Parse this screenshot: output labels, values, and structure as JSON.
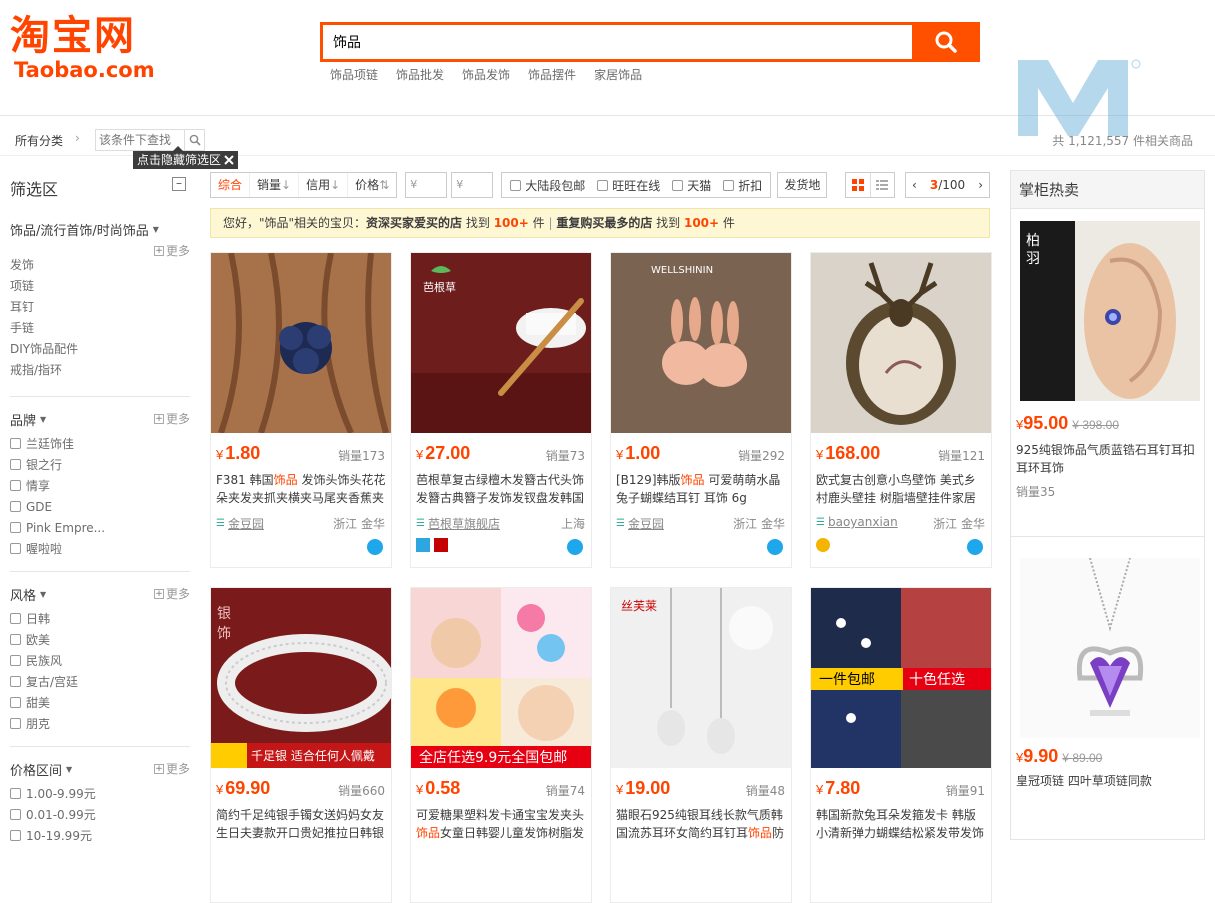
{
  "header": {
    "logo_cn": "淘宝网",
    "logo_en": "Taobao.com",
    "search_value": "饰品",
    "hotwords": [
      "饰品项链",
      "饰品批发",
      "饰品发饰",
      "饰品摆件",
      "家居饰品"
    ],
    "accent": "#ff5000"
  },
  "crumb": {
    "all": "所有分类",
    "placeholder": "该条件下查找",
    "total": "共 1,121,557 件相关商品"
  },
  "tooltip": "点击隐藏筛选区",
  "sidebar": {
    "title": "筛选区",
    "more": "更多",
    "category": {
      "head": "饰品/流行首饰/时尚饰品",
      "items": [
        "发饰",
        "项链",
        "耳钉",
        "手链",
        "DIY饰品配件",
        "戒指/指环"
      ]
    },
    "brand": {
      "head": "品牌",
      "items": [
        "兰廷饰佳",
        "银之行",
        "情享",
        "GDE",
        "Pink Empre...",
        "喔啦啦"
      ]
    },
    "style": {
      "head": "风格",
      "items": [
        "日韩",
        "欧美",
        "民族风",
        "复古/宫廷",
        "甜美",
        "朋克"
      ]
    },
    "price": {
      "head": "价格区间",
      "items": [
        "1.00-9.99元",
        "0.01-0.99元",
        "10-19.99元"
      ]
    }
  },
  "sortbar": {
    "sorts": [
      "综合",
      "销量",
      "信用",
      "价格"
    ],
    "price_from": "¥",
    "price_to": "¥",
    "checks": [
      "大陆段包邮",
      "旺旺在线",
      "天猫",
      "折扣"
    ],
    "ship": "发货地",
    "page_current": "3",
    "page_total": "/100"
  },
  "notice": {
    "pre": "您好，\"饰品\"相关的宝贝：",
    "a_label": "资深买家爱买的店",
    "a_find": " 找到 ",
    "a_count": "100+",
    "a_unit": " 件",
    "sep": " | ",
    "b_label": "重复购买最多的店",
    "b_find": " 找到 ",
    "b_count": "100+",
    "b_unit": " 件"
  },
  "products": [
    {
      "price": "1.80",
      "sales": "销量173",
      "title": "F381 韩国饰品 发饰头饰头花花朵夹发夹抓夹横夹马尾夹香蕉夹",
      "shop": "金豆园",
      "loc": "浙江 金华"
    },
    {
      "price": "27.00",
      "sales": "销量73",
      "title": "芭根草复古绿檀木发簪古代头饰发簪古典簪子发饰发钗盘发韩国",
      "shop": "芭根草旗舰店",
      "loc": "上海"
    },
    {
      "price": "1.00",
      "sales": "销量292",
      "title": "[B129]韩版饰品 可爱萌萌水晶兔子蝴蝶结耳钉 耳饰 6g",
      "shop": "金豆园",
      "loc": "浙江 金华"
    },
    {
      "price": "168.00",
      "sales": "销量121",
      "title": "欧式复古创意小鸟壁饰 美式乡村鹿头壁挂 树脂墙壁挂件家居",
      "shop": "baoyanxian",
      "loc": "浙江 金华"
    },
    {
      "price": "69.90",
      "sales": "销量660",
      "title": "简约千足纯银手镯女送妈妈女友生日夫妻款开口贵妃推拉日韩银",
      "shop": "",
      "loc": ""
    },
    {
      "price": "0.58",
      "sales": "销量74",
      "title": "可爱糖果塑料发卡通宝宝发夹头饰品女童日韩婴儿童发饰树脂发",
      "shop": "",
      "loc": ""
    },
    {
      "price": "19.00",
      "sales": "销量48",
      "title": "猫眼石925纯银耳线长款气质韩国流苏耳环女简约耳钉耳饰品防",
      "shop": "",
      "loc": ""
    },
    {
      "price": "7.80",
      "sales": "销量91",
      "title": "韩国新款兔耳朵发箍发卡 韩版小清新弹力蝴蝶结松紧发带发饰",
      "shop": "",
      "loc": ""
    }
  ],
  "right_panel": {
    "title": "掌柜热卖",
    "items": [
      {
        "price": "95.00",
        "old": "398.00",
        "title": "925纯银饰品气质蓝锆石耳钉耳扣耳环耳饰",
        "sales": "销量35"
      },
      {
        "price": "9.90",
        "old": "89.00",
        "title": "皇冠项链 四叶草项链同款",
        "sales": ""
      }
    ]
  },
  "currency": "¥",
  "highlight_word": "饰品"
}
